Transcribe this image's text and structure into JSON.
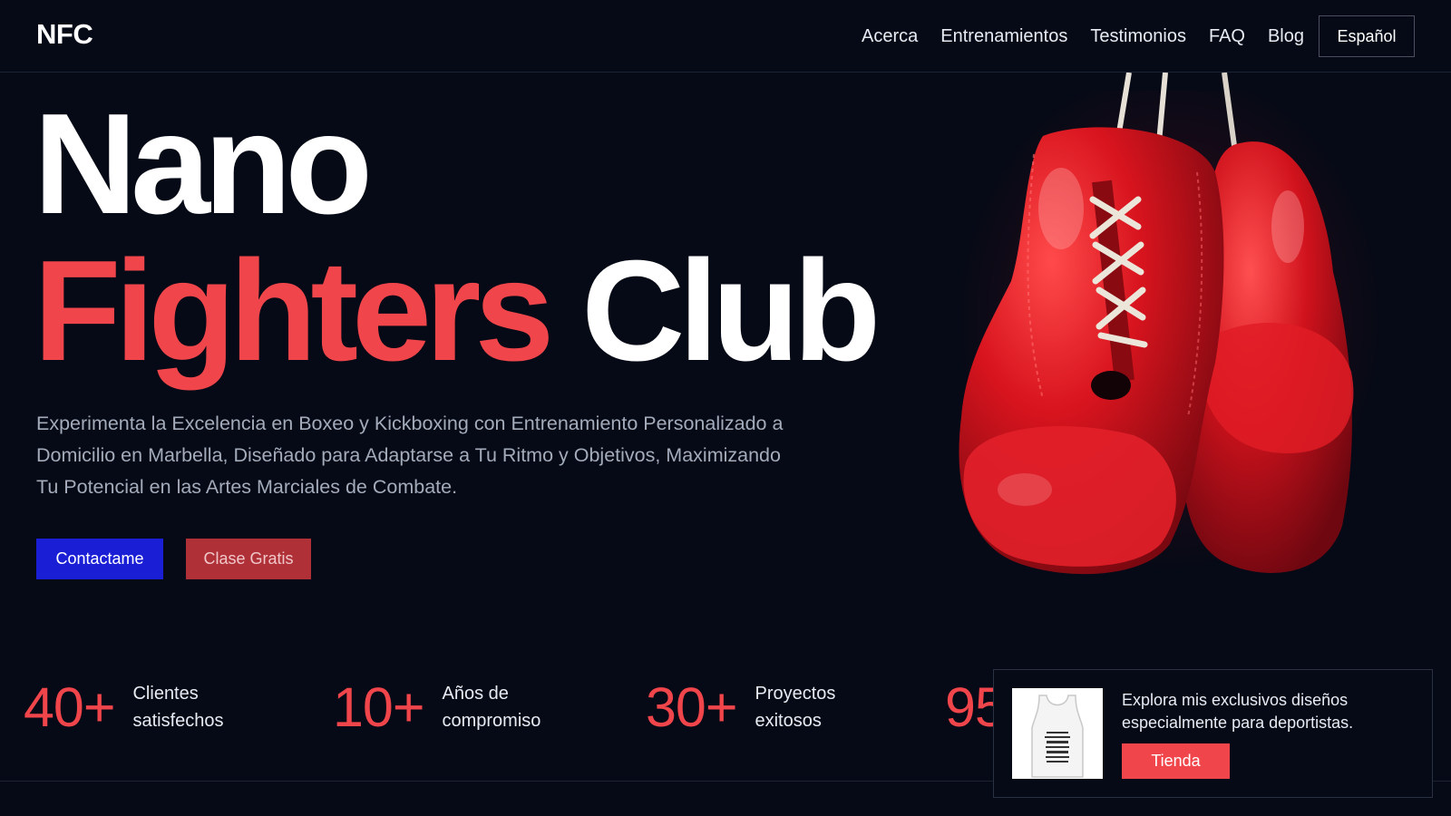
{
  "header": {
    "logo": "NFC",
    "nav": [
      "Acerca",
      "Entrenamientos",
      "Testimonios",
      "FAQ",
      "Blog"
    ],
    "language_label": "Español"
  },
  "hero": {
    "title_line1": "Nano",
    "title_line2_accent": "Fighters",
    "title_line2_rest": "Club",
    "subtitle": "Experimenta la Excelencia en Boxeo y Kickboxing con Entrenamiento Personalizado a Domicilio en Marbella, Diseñado para Adaptarse a Tu Ritmo y Objetivos, Maximizando Tu Potencial en las Artes Marciales de Combate.",
    "primary_button": "Contactame",
    "secondary_button": "Clase Gratis",
    "image_icon": "boxing-gloves-image"
  },
  "stats": [
    {
      "value": "40+",
      "label": "Clientes satisfechos"
    },
    {
      "value": "10+",
      "label": "Años de compromiso"
    },
    {
      "value": "30+",
      "label": "Proyectos exitosos"
    },
    {
      "value": "95"
    }
  ],
  "promo": {
    "text": "Explora mis exclusivos diseños especialmente para deportistas.",
    "button": "Tienda",
    "image_icon": "tank-top-image"
  },
  "colors": {
    "background": "#050a16",
    "accent_red": "#f0454a",
    "primary_blue": "#1a1fd6",
    "secondary_red": "#b03038"
  }
}
